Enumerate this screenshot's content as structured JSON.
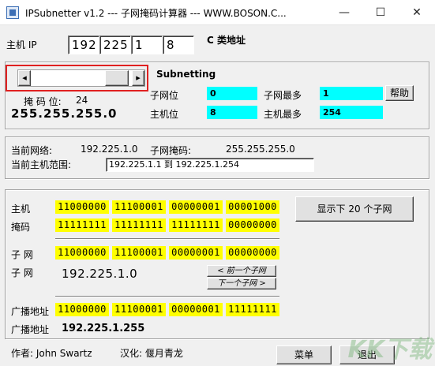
{
  "window": {
    "title": "IPSubnetter v1.2        --- 子网掩码计算器 ---        WWW.BOSON.C...",
    "minimize": "—",
    "maximize": "☐",
    "close": "✕"
  },
  "host_ip": {
    "label": "主机 IP",
    "octets": [
      "192",
      "225",
      "1",
      "8"
    ],
    "class_label": "C 类地址"
  },
  "subnetting": {
    "title": "Subnetting",
    "scroll_left": "◂",
    "scroll_right": "▸",
    "mask_bits_label": "掩 码 位:",
    "mask_bits_value": "24",
    "mask_value": "255.255.255.0",
    "subnet_bits_label": "子网位",
    "subnet_bits_value": "0",
    "host_bits_label": "主机位",
    "host_bits_value": "8",
    "max_subnets_label": "子网最多",
    "max_subnets_value": "1",
    "max_hosts_label": "主机最多",
    "max_hosts_value": "254",
    "help_button": "帮助"
  },
  "network_info": {
    "current_network_label": "当前网络:",
    "current_network_value": "192.225.1.0",
    "subnet_mask_label": "子网掩码:",
    "subnet_mask_value": "255.255.255.0",
    "host_range_label": "当前主机范围:",
    "host_range_value": "192.225.1.1  到 192.225.1.254"
  },
  "binary": {
    "host_label": "主机",
    "host_bits": [
      "11000000",
      "11100001",
      "00000001",
      "00001000"
    ],
    "mask_label": "掩码",
    "mask_bits": [
      "11111111",
      "11111111",
      "11111111",
      "00000000"
    ],
    "subnet_label": "子 网",
    "subnet_bits": [
      "11000000",
      "11100001",
      "00000001",
      "00000000"
    ],
    "subnet_label2": "子 网",
    "subnet_value": "192.225.1.0",
    "prev_subnet_button": "< 前一个子网",
    "next_subnet_button": "下一个子网 >",
    "broadcast_label": "广播地址",
    "broadcast_bits": [
      "11000000",
      "11100001",
      "00000001",
      "11111111"
    ],
    "broadcast_label2": "广播地址",
    "broadcast_value": "192.225.1.255",
    "show_subnets_button": "显示下 20 个子网"
  },
  "footer": {
    "author": "作者: John Swartz",
    "translator": "汉化: 偃月青龙",
    "menu_button": "菜单",
    "exit_button": "退出"
  },
  "watermark": "KK下载"
}
